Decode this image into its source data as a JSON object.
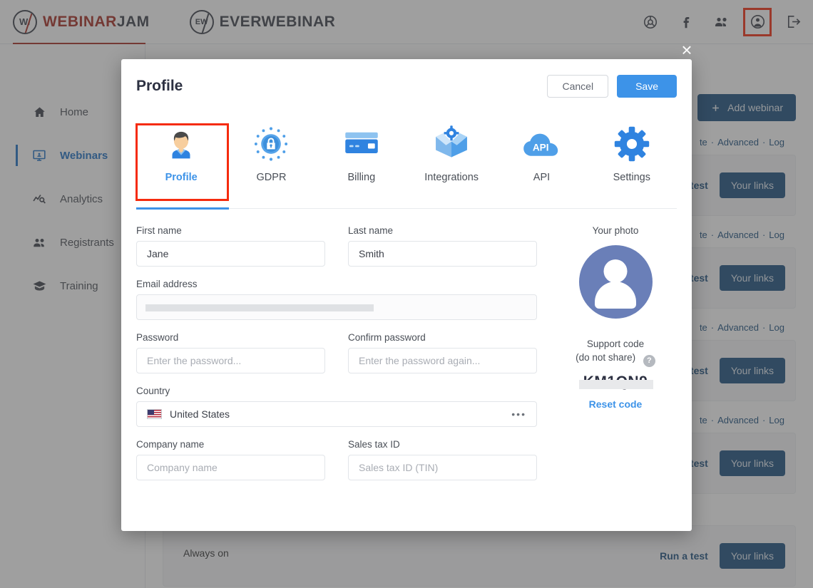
{
  "topbar": {
    "brands": [
      {
        "name": "webinarjam",
        "mark": "W/",
        "text_accent": "WEBINAR",
        "text_rest": "JAM"
      },
      {
        "name": "everwebinar",
        "mark": "EW",
        "text_accent": "",
        "text_rest": "EVERWEBINAR"
      }
    ],
    "icons": [
      {
        "name": "support-lifebuoy-icon",
        "label": "Support"
      },
      {
        "name": "facebook-icon",
        "label": "Facebook"
      },
      {
        "name": "community-people-icon",
        "label": "Community"
      },
      {
        "name": "account-icon",
        "label": "Account",
        "highlighted": true
      },
      {
        "name": "logout-icon",
        "label": "Log out"
      }
    ]
  },
  "sidebar": {
    "items": [
      {
        "label": "Home",
        "icon": "home-icon",
        "active": false
      },
      {
        "label": "Webinars",
        "icon": "webinar-screen-icon",
        "active": true
      },
      {
        "label": "Analytics",
        "icon": "analytics-icon",
        "active": false
      },
      {
        "label": "Registrants",
        "icon": "registrants-icon",
        "active": false
      },
      {
        "label": "Training",
        "icon": "training-cap-icon",
        "active": false
      }
    ]
  },
  "background": {
    "add_webinar_label": "Add webinar",
    "rows": [
      {
        "links": [
          "te",
          "Advanced",
          "Log"
        ],
        "run_test": "a test",
        "your_links": "Your links"
      },
      {
        "links": [
          "te",
          "Advanced",
          "Log"
        ],
        "run_test": "a test",
        "your_links": "Your links"
      },
      {
        "links": [
          "te",
          "Advanced",
          "Log"
        ],
        "run_test": "a test",
        "your_links": "Your links"
      },
      {
        "links": [
          "te",
          "Advanced",
          "Log"
        ],
        "run_test": "a test",
        "your_links": "Your links"
      }
    ],
    "last_row": {
      "schedule": "Always on",
      "run_test": "Run a test",
      "your_links": "Your links"
    }
  },
  "modal": {
    "close_label": "×",
    "title": "Profile",
    "cancel_label": "Cancel",
    "save_label": "Save",
    "tabs": [
      {
        "label": "Profile",
        "icon": "profile-avatar-icon",
        "active": true
      },
      {
        "label": "GDPR",
        "icon": "gdpr-lock-stars-icon",
        "active": false
      },
      {
        "label": "Billing",
        "icon": "billing-card-icon",
        "active": false
      },
      {
        "label": "Integrations",
        "icon": "integrations-box-gear-icon",
        "active": false
      },
      {
        "label": "API",
        "icon": "api-cloud-icon",
        "active": false
      },
      {
        "label": "Settings",
        "icon": "settings-gear-icon",
        "active": false
      }
    ],
    "form": {
      "first_name": {
        "label": "First name",
        "value": "Jane"
      },
      "last_name": {
        "label": "Last name",
        "value": "Smith"
      },
      "email": {
        "label": "Email address",
        "value": "",
        "redacted": true
      },
      "password": {
        "label": "Password",
        "placeholder": "Enter the password..."
      },
      "confirm_password": {
        "label": "Confirm password",
        "placeholder": "Enter the password again..."
      },
      "country": {
        "label": "Country",
        "value": "United States",
        "flag": "us-flag-icon",
        "menu_glyph": "•••"
      },
      "company": {
        "label": "Company name",
        "placeholder": "Company name"
      },
      "tax_id": {
        "label": "Sales tax ID",
        "placeholder": "Sales tax ID (TIN)"
      }
    },
    "side": {
      "photo_label": "Your photo",
      "support_label_line1": "Support code",
      "support_label_line2": "(do not share)",
      "help_glyph": "?",
      "support_code": "KM1QN9",
      "reset_label": "Reset code"
    }
  },
  "colors": {
    "accent_blue": "#3d93e8",
    "nav_blue": "#1d6fc4",
    "dark_blue": "#1b4f7e",
    "brand_red": "#a52a21",
    "highlight_red": "#f52b0e",
    "avatar_purple": "#6a7fb8"
  }
}
